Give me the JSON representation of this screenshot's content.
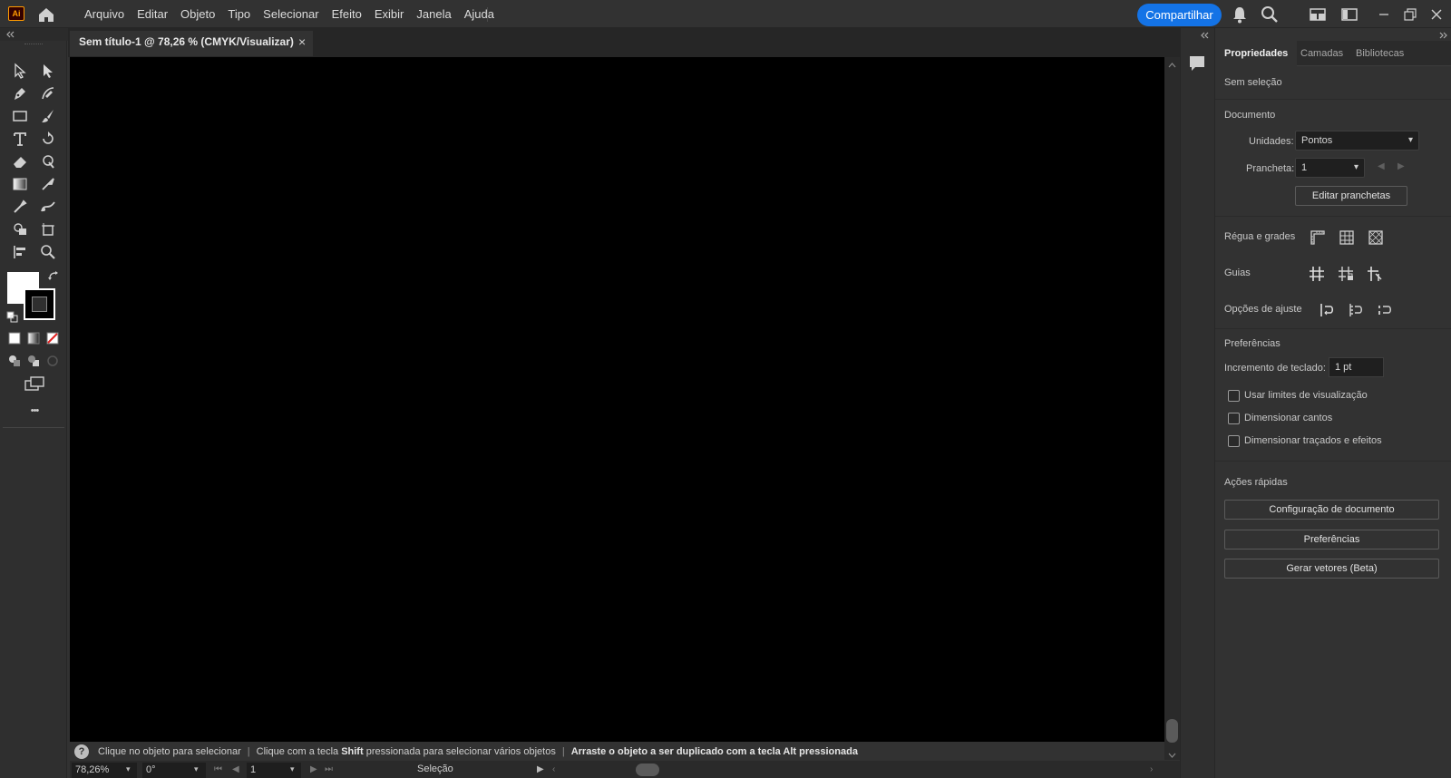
{
  "app": {
    "logo_text": "Ai",
    "accent": "#1473e6"
  },
  "menu": [
    "Arquivo",
    "Editar",
    "Objeto",
    "Tipo",
    "Selecionar",
    "Efeito",
    "Exibir",
    "Janela",
    "Ajuda"
  ],
  "header": {
    "share_label": "Compartilhar"
  },
  "document": {
    "tab_title": "Sem título-1 @ 78,26 % (CMYK/Visualizar)",
    "close_glyph": "×",
    "canvas_color": "#000000"
  },
  "toolbar": {
    "more_label": "•••",
    "fill_color": "#ffffff",
    "stroke_color": "#000000"
  },
  "hints": {
    "help_glyph": "?",
    "h1": "Clique no objeto para selecionar",
    "h2_pre": "Clique com a tecla ",
    "h2_key": "Shift",
    "h2_post": " pressionada para selecionar vários objetos",
    "h3_pre": "Arraste o objeto a ser duplicado com a tecla ",
    "h3_key": "Alt",
    "h3_post": " pressionada",
    "sep": "|"
  },
  "statusbar": {
    "zoom": "78,26%",
    "rotation": "0°",
    "artboard": "1",
    "tool": "Seleção"
  },
  "properties": {
    "tabs": [
      "Propriedades",
      "Camadas",
      "Bibliotecas"
    ],
    "no_selection": "Sem seleção",
    "document_section": "Documento",
    "units_label": "Unidades:",
    "units_value": "Pontos",
    "artboard_label": "Prancheta:",
    "artboard_value": "1",
    "edit_artboards": "Editar pranchetas",
    "rulers_grids": "Régua e grades",
    "guides": "Guias",
    "snap_options": "Opções de ajuste",
    "preferences_section": "Preferências",
    "keyboard_increment_label": "Incremento de teclado:",
    "keyboard_increment_value": "1 pt",
    "checkboxes": [
      {
        "label": "Usar limites de visualização",
        "checked": false
      },
      {
        "label": "Dimensionar cantos",
        "checked": false
      },
      {
        "label": "Dimensionar traçados e efeitos",
        "checked": false
      }
    ],
    "quick_actions": "Ações rápidas",
    "qa_buttons": [
      "Configuração de documento",
      "Preferências",
      "Gerar vetores (Beta)"
    ]
  }
}
